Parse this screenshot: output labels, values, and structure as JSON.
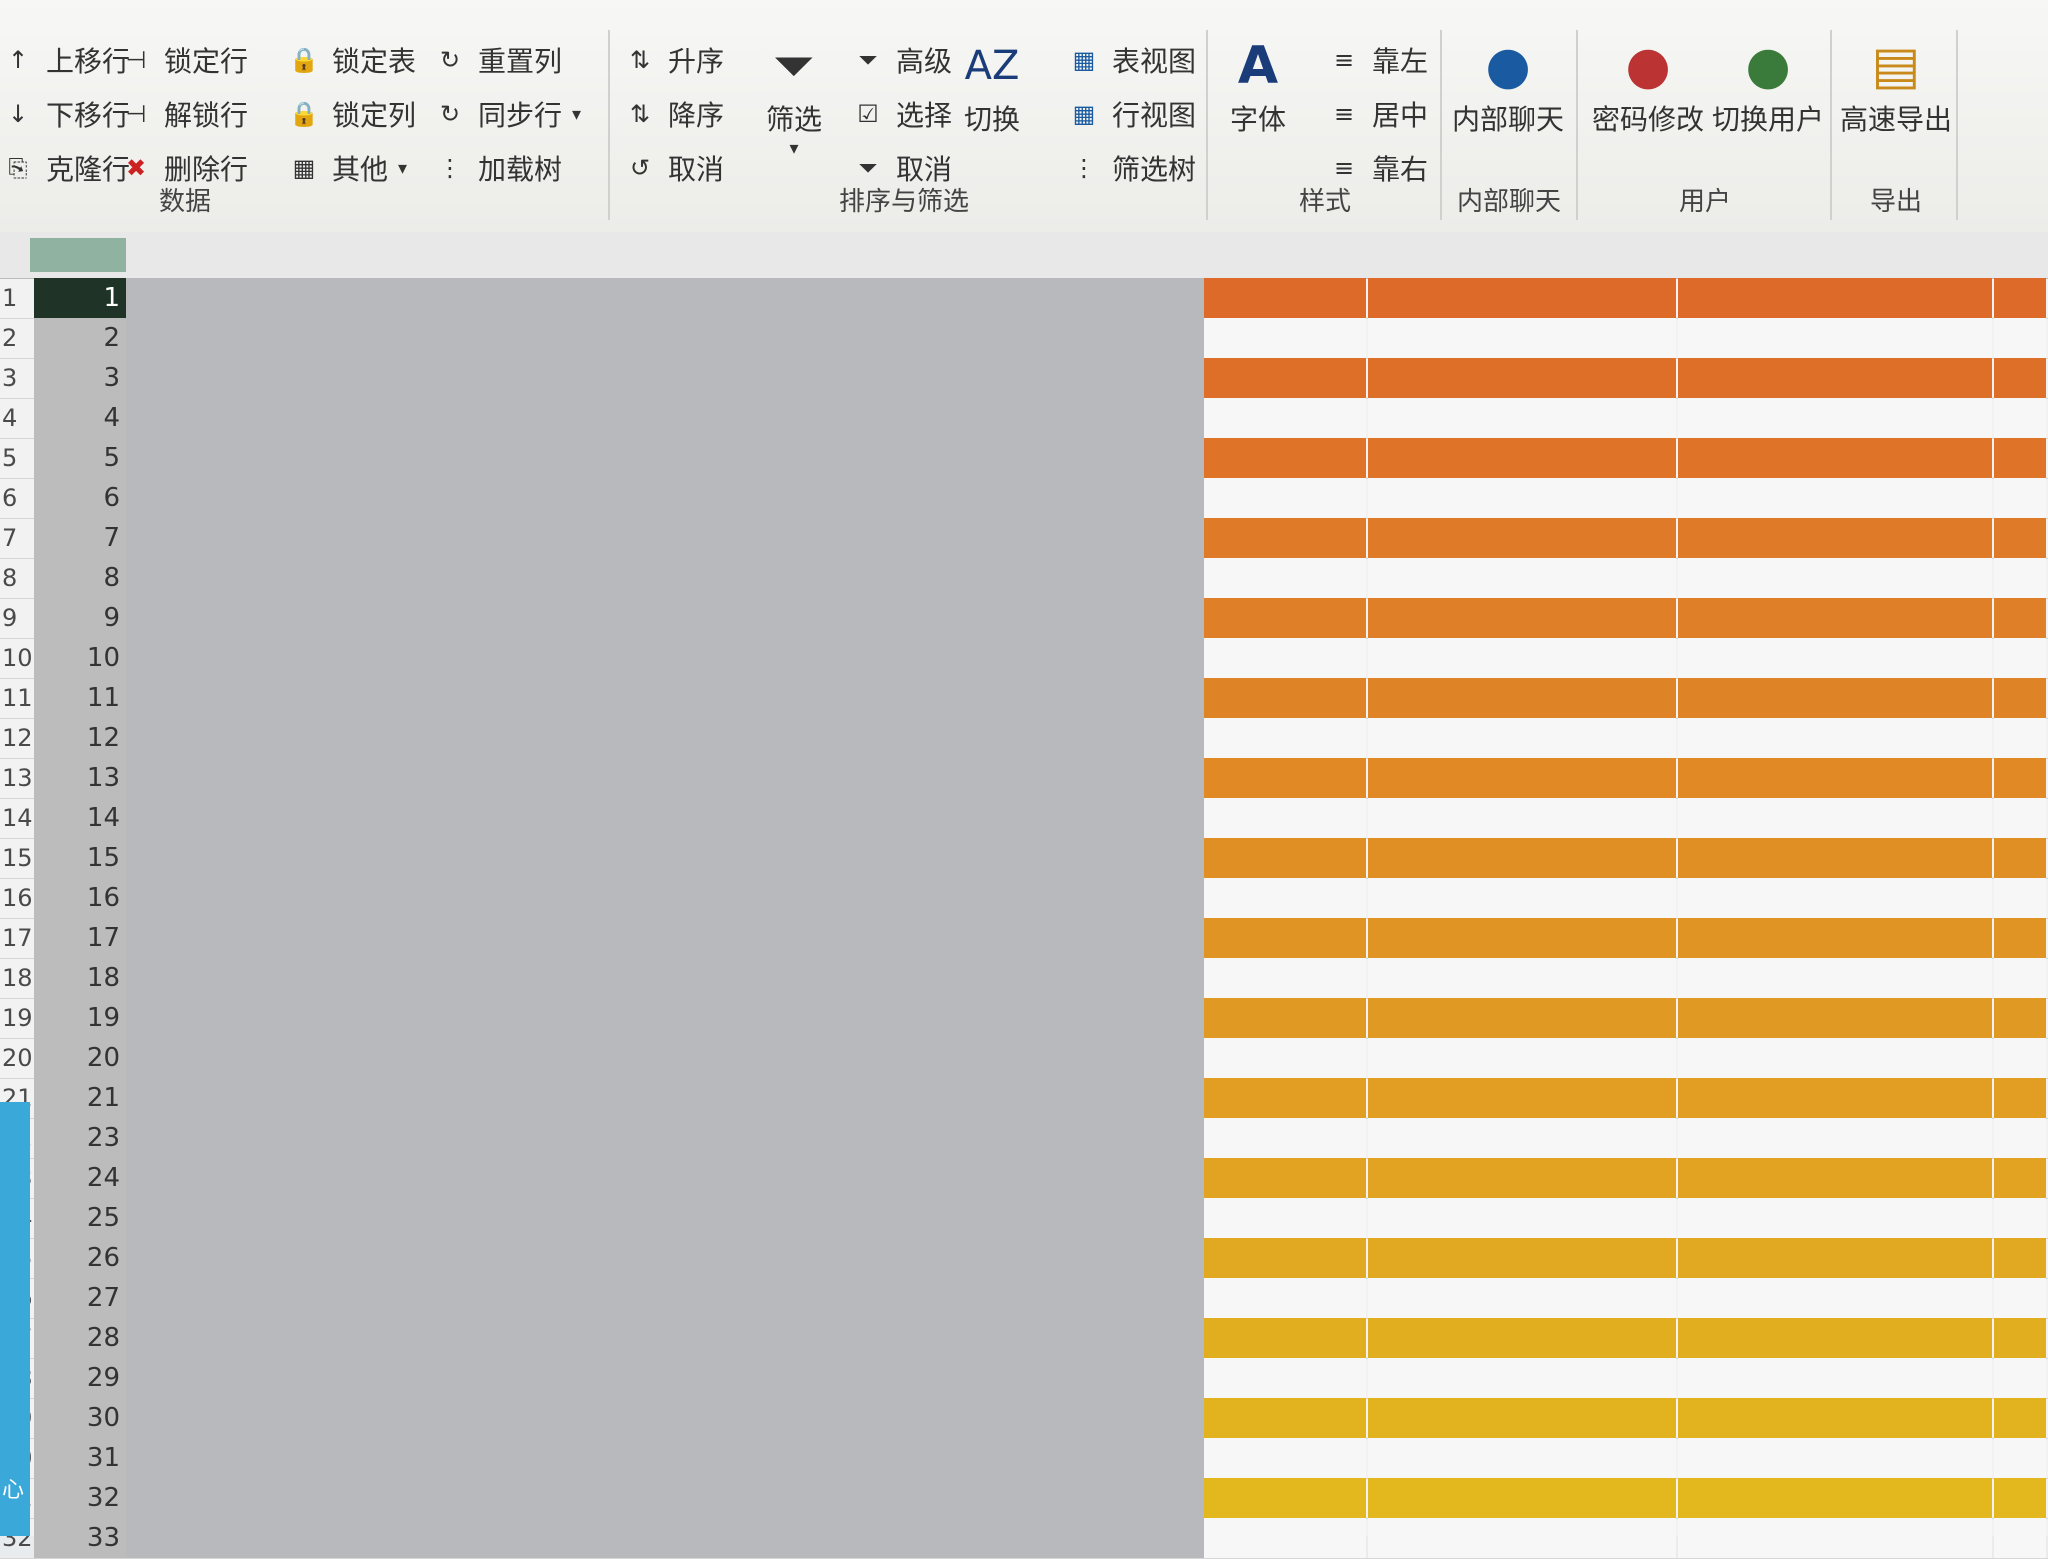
{
  "ribbon": {
    "data_group": {
      "label": "数据",
      "buttons": [
        "上移行",
        "锁定行",
        "下移行",
        "解锁行",
        "克隆行",
        "删除行",
        "锁定表",
        "重置列",
        "锁定列",
        "同步行",
        "其他",
        "加载树"
      ]
    },
    "sort_group": {
      "label": "排序与筛选",
      "asc": "升序",
      "desc": "降序",
      "cancel1": "取消",
      "filter": "筛选",
      "advanced": "高级",
      "select": "选择",
      "cancel2": "取消",
      "switch": "切换",
      "table_view": "表视图",
      "row_view": "行视图",
      "filter_tree": "筛选树"
    },
    "style_group": {
      "label": "样式",
      "font": "字体",
      "left": "靠左",
      "center": "居中",
      "right": "靠右"
    },
    "chat_group": {
      "label": "内部聊天",
      "chat": "内部聊天"
    },
    "user_group": {
      "label": "用户",
      "password": "密码修改",
      "switch_user": "切换用户"
    },
    "export_group": {
      "label": "导出",
      "fast_export": "高速导出"
    }
  },
  "sheet": {
    "rows": [
      {
        "n": "1",
        "i": "1"
      },
      {
        "n": "2",
        "i": "2"
      },
      {
        "n": "3",
        "i": "3"
      },
      {
        "n": "4",
        "i": "4"
      },
      {
        "n": "5",
        "i": "5"
      },
      {
        "n": "6",
        "i": "6"
      },
      {
        "n": "7",
        "i": "7"
      },
      {
        "n": "8",
        "i": "8"
      },
      {
        "n": "9",
        "i": "9"
      },
      {
        "n": "10",
        "i": "10"
      },
      {
        "n": "11",
        "i": "11"
      },
      {
        "n": "12",
        "i": "12"
      },
      {
        "n": "13",
        "i": "13"
      },
      {
        "n": "14",
        "i": "14"
      },
      {
        "n": "15",
        "i": "15"
      },
      {
        "n": "16",
        "i": "16"
      },
      {
        "n": "17",
        "i": "17"
      },
      {
        "n": "18",
        "i": "18"
      },
      {
        "n": "19",
        "i": "19"
      },
      {
        "n": "20",
        "i": "20"
      },
      {
        "n": "21",
        "i": "21"
      },
      {
        "n": "22",
        "i": "23"
      },
      {
        "n": "23",
        "i": "24"
      },
      {
        "n": "24",
        "i": "25"
      },
      {
        "n": "25",
        "i": "26"
      },
      {
        "n": "26",
        "i": "27"
      },
      {
        "n": "27",
        "i": "28"
      },
      {
        "n": "28",
        "i": "29"
      },
      {
        "n": "29",
        "i": "30"
      },
      {
        "n": "30",
        "i": "31"
      },
      {
        "n": "31",
        "i": "32"
      },
      {
        "n": "32",
        "i": "33"
      }
    ],
    "selected_row": "1",
    "left_label": "心",
    "colors": {
      "top": "#de6a2a",
      "bottom": "#e2bb1e",
      "white_row": "#f7f7f7"
    }
  }
}
